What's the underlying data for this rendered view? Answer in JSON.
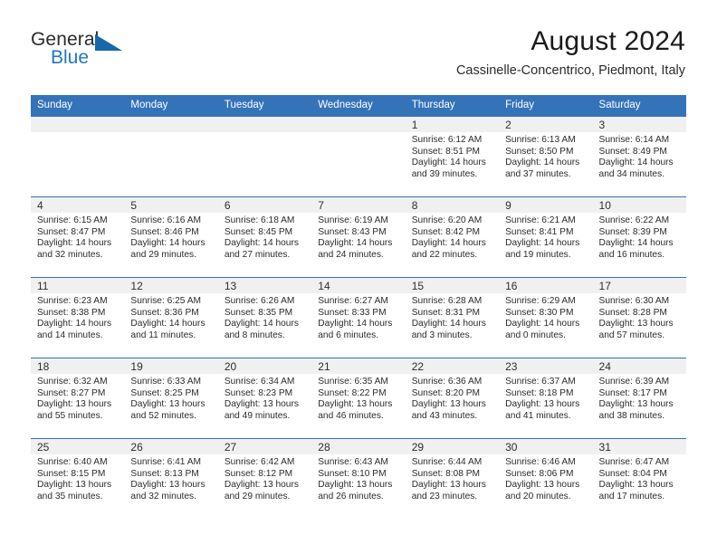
{
  "brand": {
    "name_part1": "General",
    "name_part2": "Blue",
    "triangle_icon": "brand-triangle-icon",
    "accent_color": "#1668ab",
    "text_color": "#1f77c4"
  },
  "header": {
    "title": "August 2024",
    "subtitle": "Cassinelle-Concentrico, Piedmont, Italy"
  },
  "calendar": {
    "header_bg": "#3573b9",
    "daynum_bg": "#f0f0f0",
    "weekday_headers": [
      "Sunday",
      "Monday",
      "Tuesday",
      "Wednesday",
      "Thursday",
      "Friday",
      "Saturday"
    ],
    "weeks": [
      [
        {
          "day": "",
          "sunrise": "",
          "sunset": "",
          "daylight_line1": "",
          "daylight_line2": ""
        },
        {
          "day": "",
          "sunrise": "",
          "sunset": "",
          "daylight_line1": "",
          "daylight_line2": ""
        },
        {
          "day": "",
          "sunrise": "",
          "sunset": "",
          "daylight_line1": "",
          "daylight_line2": ""
        },
        {
          "day": "",
          "sunrise": "",
          "sunset": "",
          "daylight_line1": "",
          "daylight_line2": ""
        },
        {
          "day": "1",
          "sunrise": "Sunrise: 6:12 AM",
          "sunset": "Sunset: 8:51 PM",
          "daylight_line1": "Daylight: 14 hours",
          "daylight_line2": "and 39 minutes."
        },
        {
          "day": "2",
          "sunrise": "Sunrise: 6:13 AM",
          "sunset": "Sunset: 8:50 PM",
          "daylight_line1": "Daylight: 14 hours",
          "daylight_line2": "and 37 minutes."
        },
        {
          "day": "3",
          "sunrise": "Sunrise: 6:14 AM",
          "sunset": "Sunset: 8:49 PM",
          "daylight_line1": "Daylight: 14 hours",
          "daylight_line2": "and 34 minutes."
        }
      ],
      [
        {
          "day": "4",
          "sunrise": "Sunrise: 6:15 AM",
          "sunset": "Sunset: 8:47 PM",
          "daylight_line1": "Daylight: 14 hours",
          "daylight_line2": "and 32 minutes."
        },
        {
          "day": "5",
          "sunrise": "Sunrise: 6:16 AM",
          "sunset": "Sunset: 8:46 PM",
          "daylight_line1": "Daylight: 14 hours",
          "daylight_line2": "and 29 minutes."
        },
        {
          "day": "6",
          "sunrise": "Sunrise: 6:18 AM",
          "sunset": "Sunset: 8:45 PM",
          "daylight_line1": "Daylight: 14 hours",
          "daylight_line2": "and 27 minutes."
        },
        {
          "day": "7",
          "sunrise": "Sunrise: 6:19 AM",
          "sunset": "Sunset: 8:43 PM",
          "daylight_line1": "Daylight: 14 hours",
          "daylight_line2": "and 24 minutes."
        },
        {
          "day": "8",
          "sunrise": "Sunrise: 6:20 AM",
          "sunset": "Sunset: 8:42 PM",
          "daylight_line1": "Daylight: 14 hours",
          "daylight_line2": "and 22 minutes."
        },
        {
          "day": "9",
          "sunrise": "Sunrise: 6:21 AM",
          "sunset": "Sunset: 8:41 PM",
          "daylight_line1": "Daylight: 14 hours",
          "daylight_line2": "and 19 minutes."
        },
        {
          "day": "10",
          "sunrise": "Sunrise: 6:22 AM",
          "sunset": "Sunset: 8:39 PM",
          "daylight_line1": "Daylight: 14 hours",
          "daylight_line2": "and 16 minutes."
        }
      ],
      [
        {
          "day": "11",
          "sunrise": "Sunrise: 6:23 AM",
          "sunset": "Sunset: 8:38 PM",
          "daylight_line1": "Daylight: 14 hours",
          "daylight_line2": "and 14 minutes."
        },
        {
          "day": "12",
          "sunrise": "Sunrise: 6:25 AM",
          "sunset": "Sunset: 8:36 PM",
          "daylight_line1": "Daylight: 14 hours",
          "daylight_line2": "and 11 minutes."
        },
        {
          "day": "13",
          "sunrise": "Sunrise: 6:26 AM",
          "sunset": "Sunset: 8:35 PM",
          "daylight_line1": "Daylight: 14 hours",
          "daylight_line2": "and 8 minutes."
        },
        {
          "day": "14",
          "sunrise": "Sunrise: 6:27 AM",
          "sunset": "Sunset: 8:33 PM",
          "daylight_line1": "Daylight: 14 hours",
          "daylight_line2": "and 6 minutes."
        },
        {
          "day": "15",
          "sunrise": "Sunrise: 6:28 AM",
          "sunset": "Sunset: 8:31 PM",
          "daylight_line1": "Daylight: 14 hours",
          "daylight_line2": "and 3 minutes."
        },
        {
          "day": "16",
          "sunrise": "Sunrise: 6:29 AM",
          "sunset": "Sunset: 8:30 PM",
          "daylight_line1": "Daylight: 14 hours",
          "daylight_line2": "and 0 minutes."
        },
        {
          "day": "17",
          "sunrise": "Sunrise: 6:30 AM",
          "sunset": "Sunset: 8:28 PM",
          "daylight_line1": "Daylight: 13 hours",
          "daylight_line2": "and 57 minutes."
        }
      ],
      [
        {
          "day": "18",
          "sunrise": "Sunrise: 6:32 AM",
          "sunset": "Sunset: 8:27 PM",
          "daylight_line1": "Daylight: 13 hours",
          "daylight_line2": "and 55 minutes."
        },
        {
          "day": "19",
          "sunrise": "Sunrise: 6:33 AM",
          "sunset": "Sunset: 8:25 PM",
          "daylight_line1": "Daylight: 13 hours",
          "daylight_line2": "and 52 minutes."
        },
        {
          "day": "20",
          "sunrise": "Sunrise: 6:34 AM",
          "sunset": "Sunset: 8:23 PM",
          "daylight_line1": "Daylight: 13 hours",
          "daylight_line2": "and 49 minutes."
        },
        {
          "day": "21",
          "sunrise": "Sunrise: 6:35 AM",
          "sunset": "Sunset: 8:22 PM",
          "daylight_line1": "Daylight: 13 hours",
          "daylight_line2": "and 46 minutes."
        },
        {
          "day": "22",
          "sunrise": "Sunrise: 6:36 AM",
          "sunset": "Sunset: 8:20 PM",
          "daylight_line1": "Daylight: 13 hours",
          "daylight_line2": "and 43 minutes."
        },
        {
          "day": "23",
          "sunrise": "Sunrise: 6:37 AM",
          "sunset": "Sunset: 8:18 PM",
          "daylight_line1": "Daylight: 13 hours",
          "daylight_line2": "and 41 minutes."
        },
        {
          "day": "24",
          "sunrise": "Sunrise: 6:39 AM",
          "sunset": "Sunset: 8:17 PM",
          "daylight_line1": "Daylight: 13 hours",
          "daylight_line2": "and 38 minutes."
        }
      ],
      [
        {
          "day": "25",
          "sunrise": "Sunrise: 6:40 AM",
          "sunset": "Sunset: 8:15 PM",
          "daylight_line1": "Daylight: 13 hours",
          "daylight_line2": "and 35 minutes."
        },
        {
          "day": "26",
          "sunrise": "Sunrise: 6:41 AM",
          "sunset": "Sunset: 8:13 PM",
          "daylight_line1": "Daylight: 13 hours",
          "daylight_line2": "and 32 minutes."
        },
        {
          "day": "27",
          "sunrise": "Sunrise: 6:42 AM",
          "sunset": "Sunset: 8:12 PM",
          "daylight_line1": "Daylight: 13 hours",
          "daylight_line2": "and 29 minutes."
        },
        {
          "day": "28",
          "sunrise": "Sunrise: 6:43 AM",
          "sunset": "Sunset: 8:10 PM",
          "daylight_line1": "Daylight: 13 hours",
          "daylight_line2": "and 26 minutes."
        },
        {
          "day": "29",
          "sunrise": "Sunrise: 6:44 AM",
          "sunset": "Sunset: 8:08 PM",
          "daylight_line1": "Daylight: 13 hours",
          "daylight_line2": "and 23 minutes."
        },
        {
          "day": "30",
          "sunrise": "Sunrise: 6:46 AM",
          "sunset": "Sunset: 8:06 PM",
          "daylight_line1": "Daylight: 13 hours",
          "daylight_line2": "and 20 minutes."
        },
        {
          "day": "31",
          "sunrise": "Sunrise: 6:47 AM",
          "sunset": "Sunset: 8:04 PM",
          "daylight_line1": "Daylight: 13 hours",
          "daylight_line2": "and 17 minutes."
        }
      ]
    ]
  }
}
